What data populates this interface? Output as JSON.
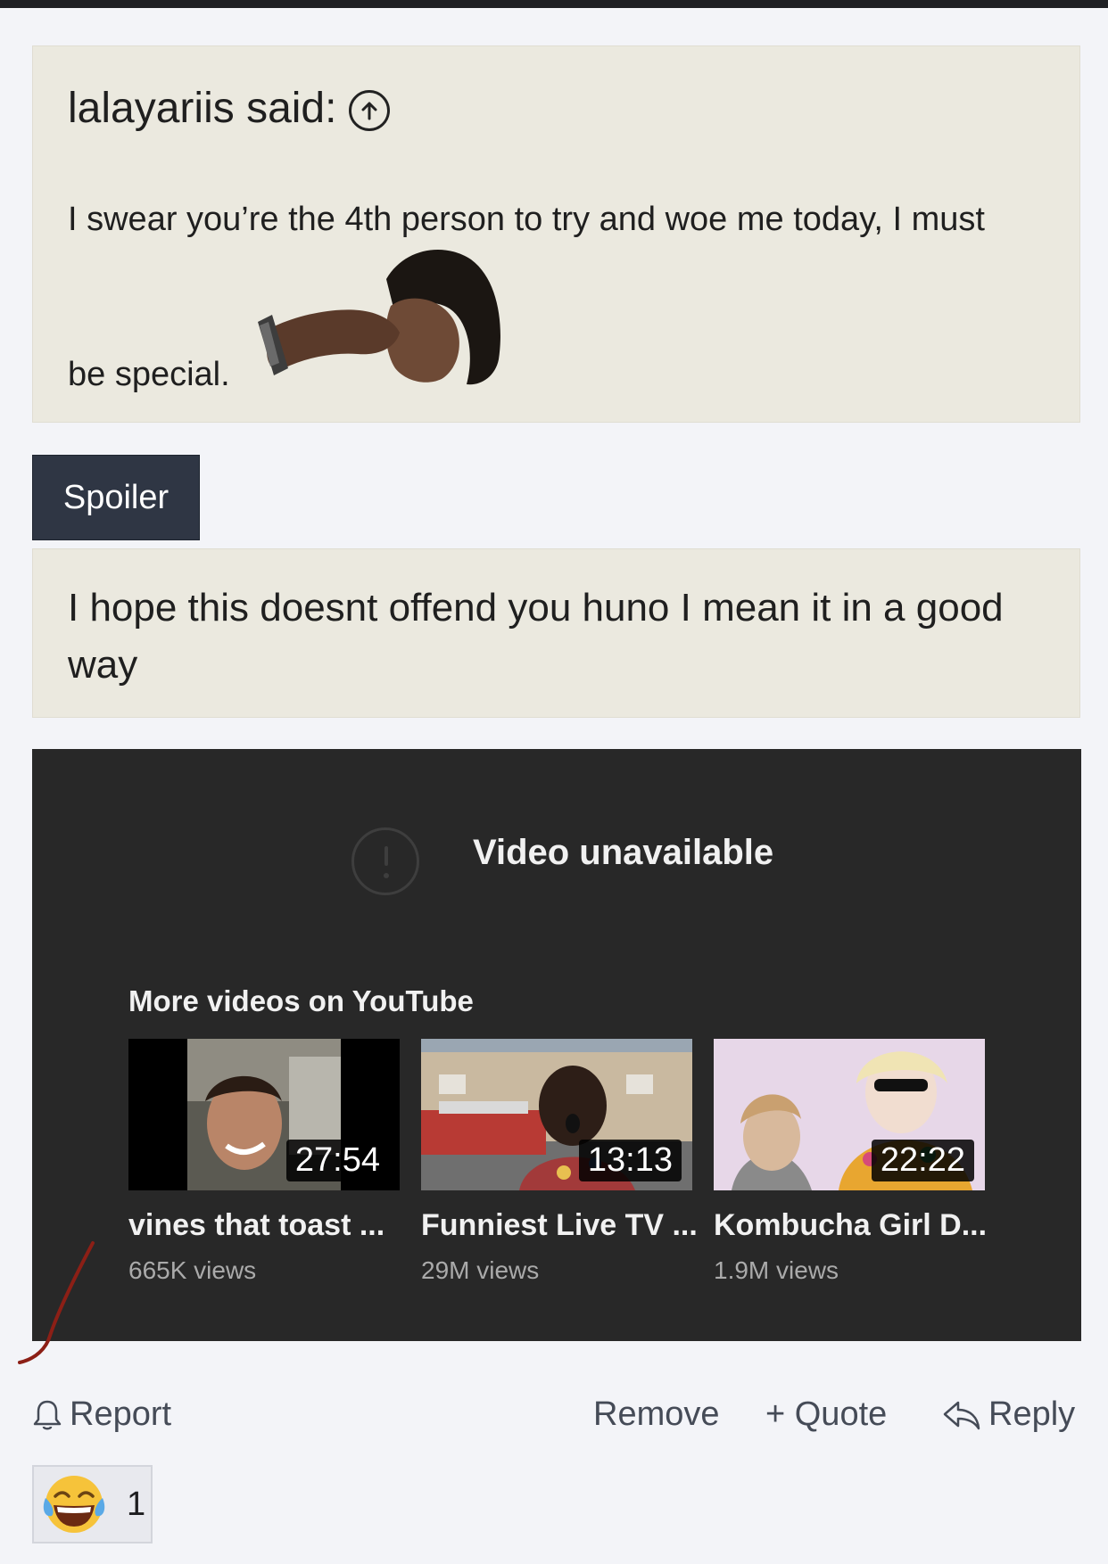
{
  "quote": {
    "author_label": "lalayariis said:",
    "line1": "I swear you’re the 4th person to try and woe me today, I must",
    "line2": "be special."
  },
  "spoiler": {
    "label": "Spoiler"
  },
  "reply": {
    "text": "I hope this doesnt offend you huno I mean it in a good way"
  },
  "youtube": {
    "unavailable_text": "Video unavailable",
    "more_videos_label": "More videos on YouTube",
    "videos": [
      {
        "title": "vines that toast ...",
        "views": "665K views",
        "duration": "27:54"
      },
      {
        "title": "Funniest Live TV ...",
        "views": "29M views",
        "duration": "13:13"
      },
      {
        "title": "Kombucha Girl D...",
        "views": "1.9M views",
        "duration": "22:22"
      }
    ]
  },
  "actions": {
    "report": "Report",
    "remove": "Remove",
    "quote": "+ Quote",
    "reply": "Reply"
  },
  "reaction": {
    "emoji": "😂",
    "count": "1"
  }
}
